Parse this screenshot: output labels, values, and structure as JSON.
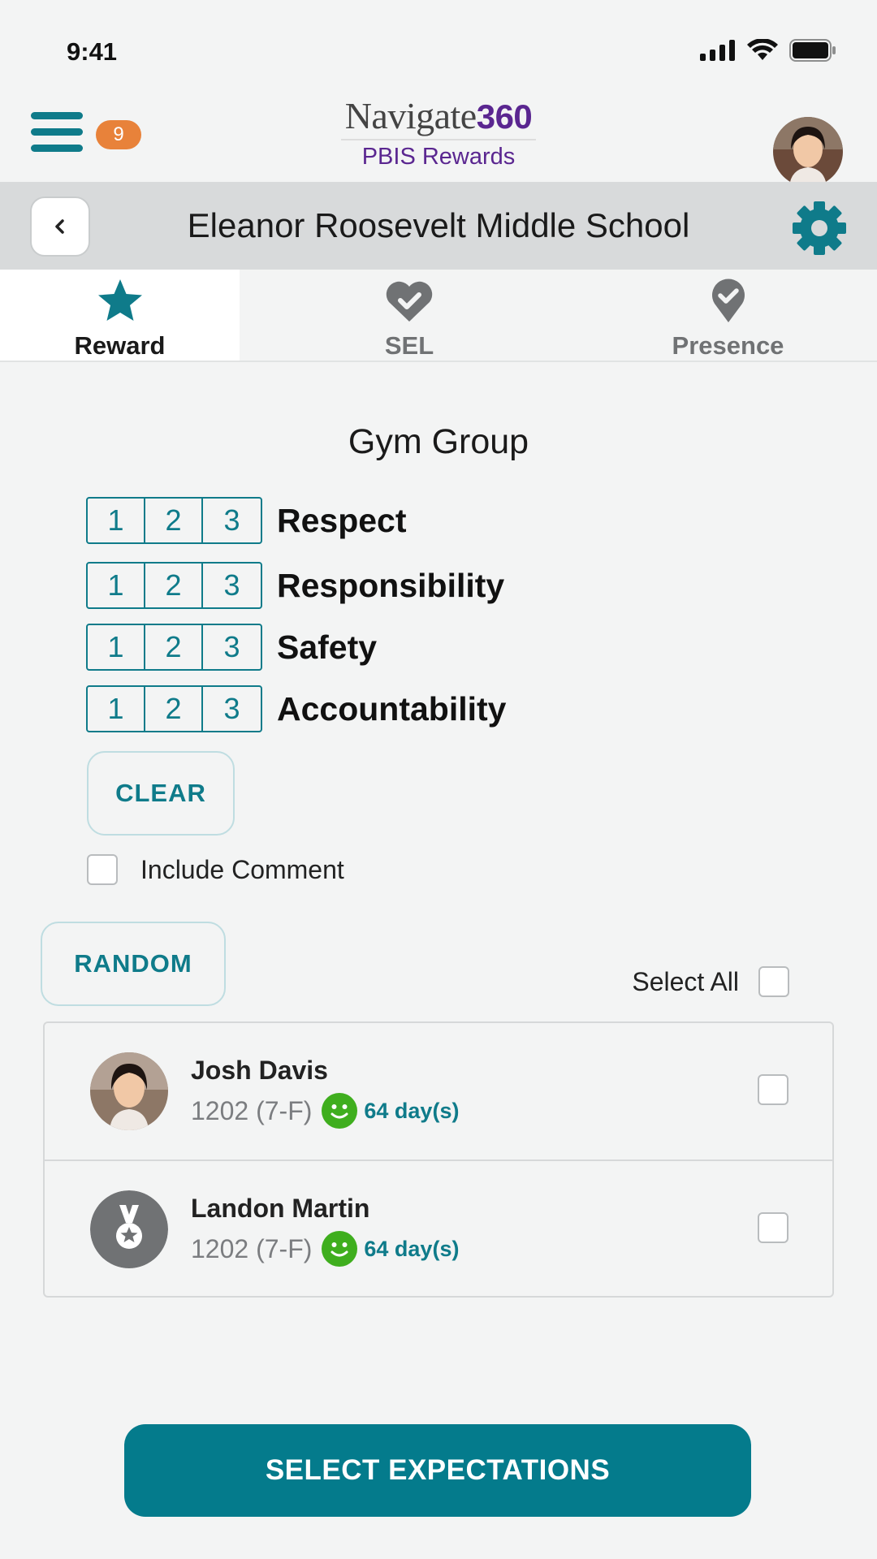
{
  "status_bar": {
    "time": "9:41"
  },
  "header": {
    "logo_main": "Navigate",
    "logo_number": "360",
    "logo_sub": "PBIS Rewards",
    "notification_count": "9"
  },
  "school": {
    "name": "Eleanor Roosevelt Middle School"
  },
  "tabs": [
    {
      "label": "Reward",
      "icon": "star-icon",
      "active": true
    },
    {
      "label": "SEL",
      "icon": "heart-check-icon",
      "active": false
    },
    {
      "label": "Presence",
      "icon": "location-check-icon",
      "active": false
    }
  ],
  "group": {
    "title": "Gym Group",
    "expectations": [
      {
        "label": "Respect",
        "points": [
          "1",
          "2",
          "3"
        ]
      },
      {
        "label": "Responsibility",
        "points": [
          "1",
          "2",
          "3"
        ]
      },
      {
        "label": "Safety",
        "points": [
          "1",
          "2",
          "3"
        ]
      },
      {
        "label": "Accountability",
        "points": [
          "1",
          "2",
          "3"
        ]
      }
    ],
    "clear_label": "CLEAR",
    "include_comment_label": "Include Comment",
    "random_label": "RANDOM",
    "select_all_label": "Select All"
  },
  "students": [
    {
      "name": "Josh Davis",
      "class": "1202 (7-F)",
      "streak": "64 day(s)",
      "avatar": "photo"
    },
    {
      "name": "Landon Martin",
      "class": "1202 (7-F)",
      "streak": "64 day(s)",
      "avatar": "medal-icon"
    }
  ],
  "primary_action": {
    "label": "SELECT EXPECTATIONS"
  },
  "colors": {
    "teal": "#0f7b8a",
    "purple": "#5a2690",
    "badge": "#e8823a",
    "green": "#3fae1e"
  }
}
